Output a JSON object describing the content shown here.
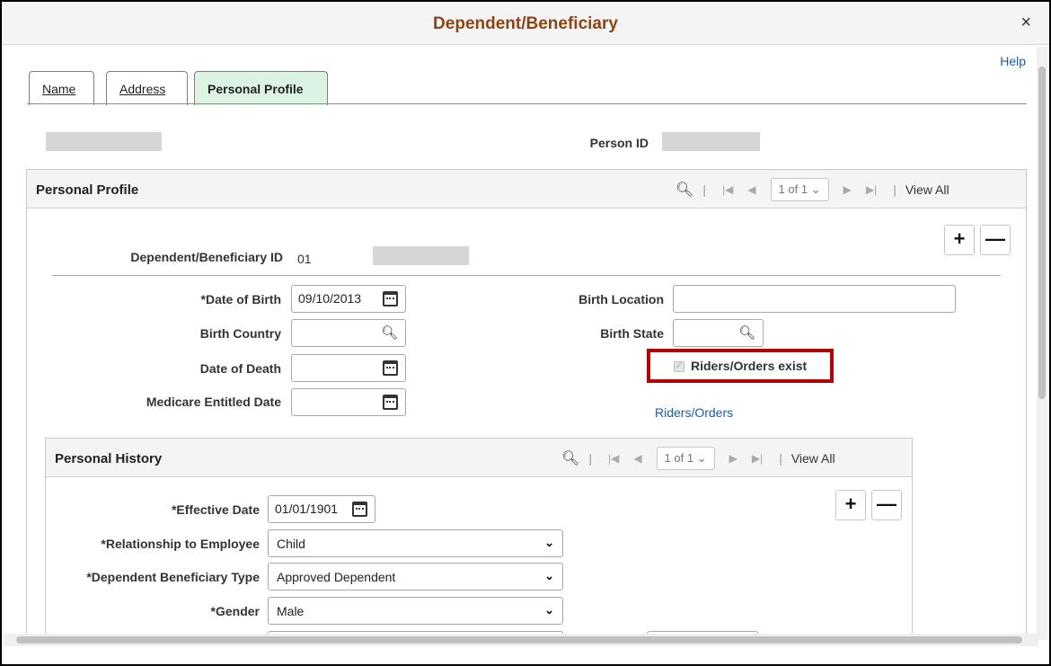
{
  "window": {
    "title": "Dependent/Beneficiary",
    "close_label": "×",
    "help_label": "Help"
  },
  "tabs": [
    {
      "label": "Name"
    },
    {
      "label": "Address"
    },
    {
      "label": "Personal Profile"
    }
  ],
  "header": {
    "person_id_label": "Person ID"
  },
  "personal_profile": {
    "title": "Personal Profile",
    "nav": {
      "pager": "1 of 1",
      "view_all": "View All"
    },
    "dep_id_label": "Dependent/Beneficiary ID",
    "dep_id_value": "01",
    "fields": {
      "dob_label": "*Date of Birth",
      "dob_value": "09/10/2013",
      "birth_country_label": "Birth Country",
      "date_of_death_label": "Date of Death",
      "medicare_label": "Medicare Entitled Date",
      "birth_location_label": "Birth Location",
      "birth_state_label": "Birth State",
      "riders_exist_label": "Riders/Orders exist",
      "riders_link": "Riders/Orders"
    }
  },
  "personal_history": {
    "title": "Personal History",
    "nav": {
      "pager": "1 of 1",
      "view_all": "View All"
    },
    "effective_date_label": "*Effective Date",
    "effective_date_value": "01/01/1901",
    "relationship_label": "*Relationship to Employee",
    "relationship_value": "Child",
    "dep_type_label": "*Dependent Beneficiary Type",
    "dep_type_value": "Approved Dependent",
    "gender_label": "*Gender",
    "gender_value": "Male"
  },
  "colors": {
    "title": "#8b4513",
    "highlight": "#b30000",
    "link": "#1f5ba5",
    "active_tab": "#dcf2e3"
  }
}
